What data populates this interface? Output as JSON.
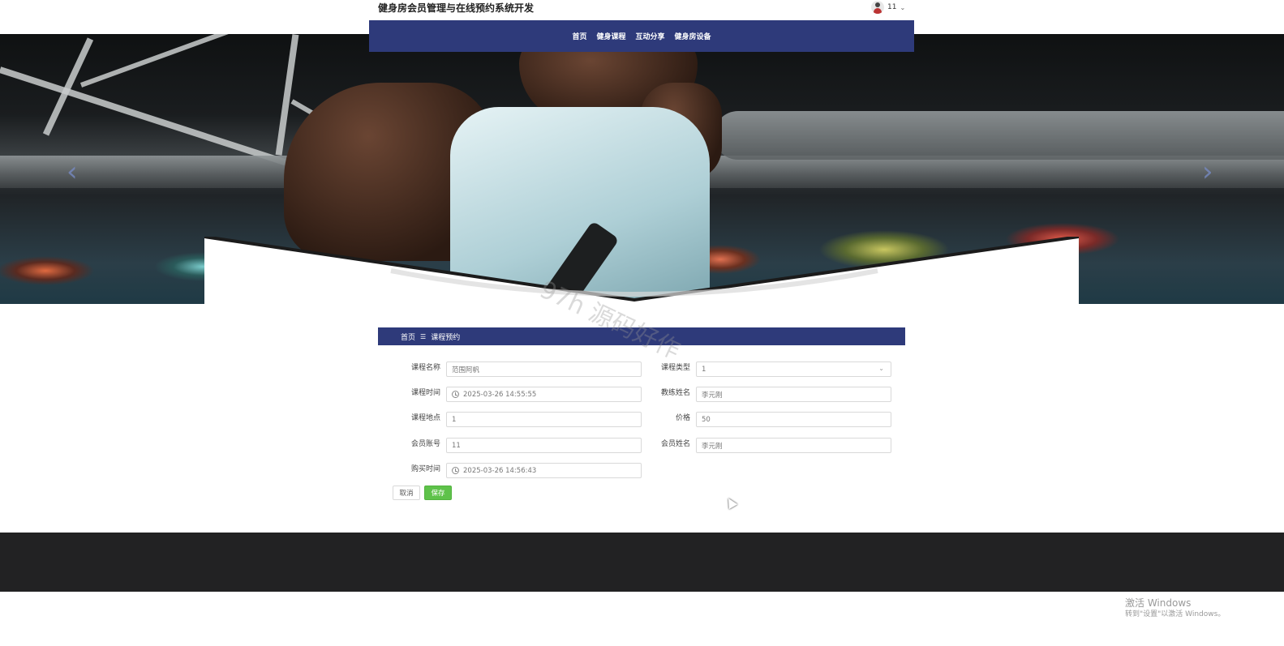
{
  "header": {
    "site_title": "健身房会员管理与在线预约系统开发",
    "user_name": "11"
  },
  "nav": {
    "items": [
      "首页",
      "健身课程",
      "互动分享",
      "健身房设备"
    ]
  },
  "banner": {
    "prev_arrow": "‹",
    "next_arrow": "›"
  },
  "watermark": "97h 源码好作",
  "breadcrumb": {
    "home": "首页",
    "separator": "☰",
    "current": "课程预约"
  },
  "form": {
    "course_name": {
      "label": "课程名称",
      "value": "范围阿帆"
    },
    "course_type": {
      "label": "课程类型",
      "value": "1"
    },
    "course_time": {
      "label": "课程时间",
      "value": "2025-03-26 14:55:55"
    },
    "coach_name": {
      "label": "教练姓名",
      "value": "李元刚"
    },
    "course_location": {
      "label": "课程地点",
      "value": "1"
    },
    "price": {
      "label": "价格",
      "value": "50"
    },
    "member_account": {
      "label": "会员账号",
      "value": "11"
    },
    "member_name": {
      "label": "会员姓名",
      "value": "李元刚"
    },
    "purchase_time": {
      "label": "购买时间",
      "value": "2025-03-26 14:56:43"
    }
  },
  "buttons": {
    "cancel": "取消",
    "save": "保存"
  },
  "os_overlay": {
    "title": "激活 Windows",
    "subtitle": "转到\"设置\"以激活 Windows。"
  },
  "colors": {
    "nav_bg": "#2e3a7a",
    "save_btn": "#5ec24a",
    "footer_bg": "#222223"
  }
}
